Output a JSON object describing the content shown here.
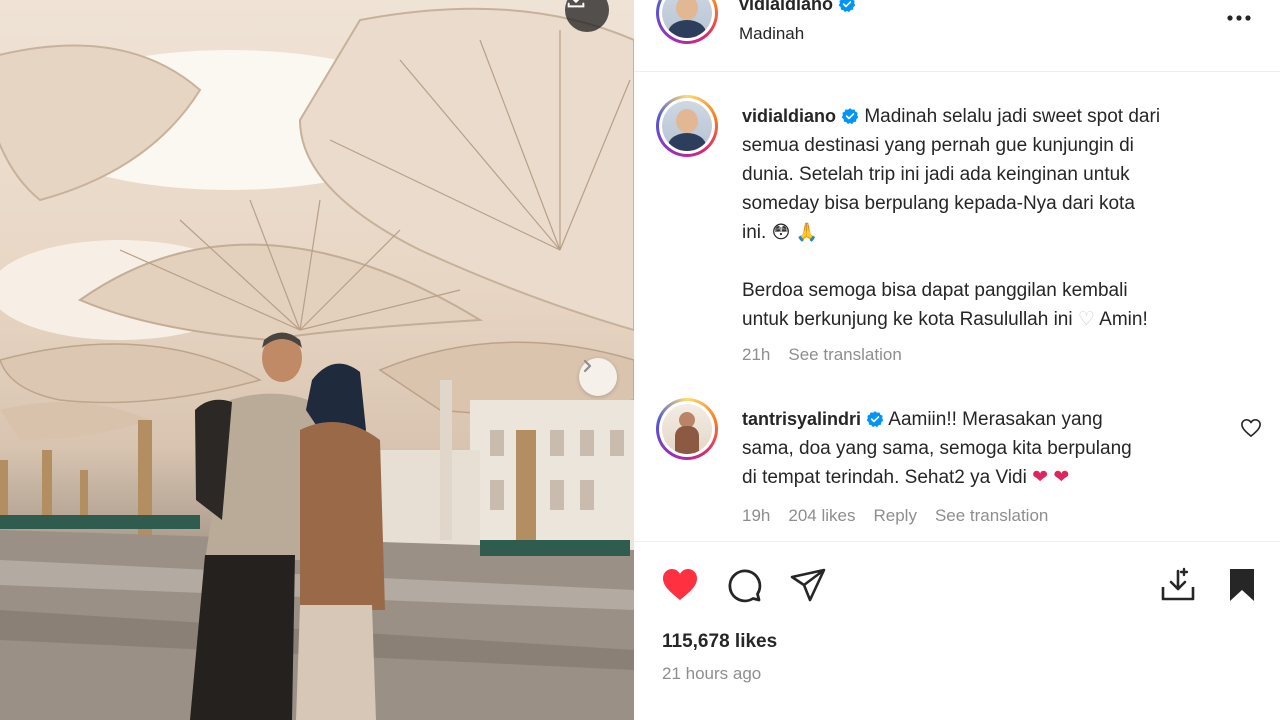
{
  "post": {
    "author": "vidialdiano",
    "location": "Madinah",
    "caption": {
      "line1": "Madinah selalu jadi sweet spot dari",
      "line2": "semua destinasi yang pernah gue kunjungin di",
      "line3": "dunia. Setelah trip ini jadi ada keinginan untuk",
      "line4": "someday bisa berpulang kepada-Nya dari kota",
      "line5": "ini.",
      "line6": "Berdoa semoga bisa dapat panggilan kembali",
      "line7a": "untuk berkunjung ke kota Rasulullah ini",
      "line7b": "Amin!"
    },
    "caption_time": "21h",
    "see_translation": "See translation",
    "likes": "115,678 likes",
    "time_ago": "21 hours ago"
  },
  "comment": {
    "author": "tantrisyalindri",
    "line1": "Aamiin!! Merasakan yang",
    "line2": "sama, doa yang sama, semoga kita berpulang",
    "line3": "di tempat terindah. Sehat2 ya Vidi",
    "time": "19h",
    "likes": "204 likes",
    "reply": "Reply",
    "see_translation": "See translation"
  },
  "icons": {
    "download": "download-icon",
    "next": "chevron-right-icon",
    "more": "more-options-icon",
    "verified": "verified-badge-icon",
    "like": "heart-filled-icon",
    "comment": "comment-icon",
    "share": "send-icon",
    "save_to_collection": "save-collection-icon",
    "bookmark": "bookmark-filled-icon"
  },
  "colors": {
    "verified": "#0095f6",
    "like_red": "#ff3040",
    "text": "#262626",
    "secondary": "#8e8e8e"
  }
}
